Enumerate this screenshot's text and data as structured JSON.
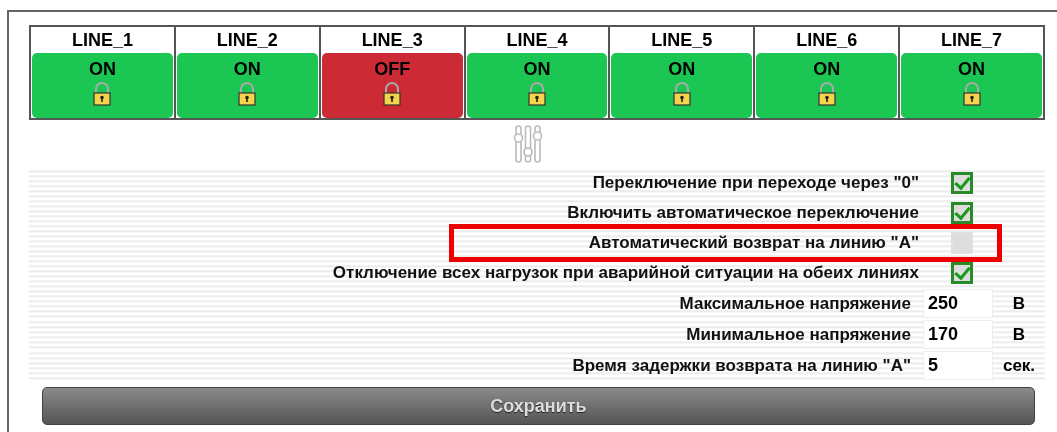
{
  "lines": [
    {
      "label": "LINE_1",
      "status": "ON",
      "on": true
    },
    {
      "label": "LINE_2",
      "status": "ON",
      "on": true
    },
    {
      "label": "LINE_3",
      "status": "OFF",
      "on": false
    },
    {
      "label": "LINE_4",
      "status": "ON",
      "on": true
    },
    {
      "label": "LINE_5",
      "status": "ON",
      "on": true
    },
    {
      "label": "LINE_6",
      "status": "ON",
      "on": true
    },
    {
      "label": "LINE_7",
      "status": "ON",
      "on": true
    }
  ],
  "settings": [
    {
      "kind": "checkbox",
      "label": "Переключение при переходе через \"0\"",
      "checked": true
    },
    {
      "kind": "checkbox",
      "label": "Включить автоматическое переключение",
      "checked": true
    },
    {
      "kind": "checkbox",
      "label": "Автоматический возврат на линию \"A\"",
      "checked": false
    },
    {
      "kind": "checkbox",
      "label": "Отключение всех нагрузок при аварийной ситуации на обеих линиях",
      "checked": true
    },
    {
      "kind": "number",
      "label": "Максимальное напряжение",
      "value": "250",
      "unit": "В"
    },
    {
      "kind": "number",
      "label": "Минимальное напряжение",
      "value": "170",
      "unit": "В"
    },
    {
      "kind": "number",
      "label": "Время задержки возврата на линию \"A\"",
      "value": "5",
      "unit": "сек."
    }
  ],
  "save_button": "Сохранить"
}
